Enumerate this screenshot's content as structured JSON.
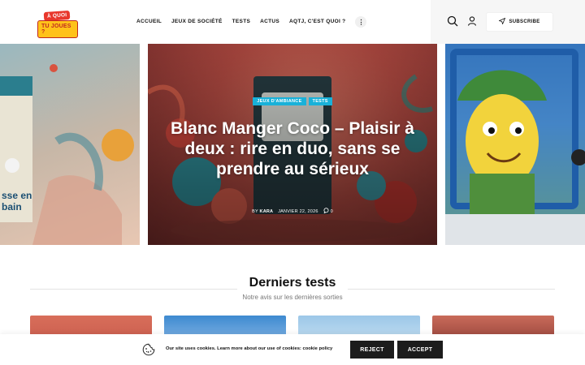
{
  "site": {
    "logo_line1": "À QUOI",
    "logo_line2": "TU JOUES ?"
  },
  "nav": {
    "items": [
      "ACCUEIL",
      "JEUX DE SOCIÉTÉ",
      "TESTS",
      "ACTUS",
      "AQTJ, C'EST QUOI ?"
    ],
    "more": "⋮"
  },
  "header": {
    "subscribe_label": "SUBSCRIBE"
  },
  "carousel": {
    "left_text_line1": "sse en",
    "left_text_line2": "bain",
    "main": {
      "tags": [
        "JEUX D'AMBIANCE",
        "TESTS"
      ],
      "title": "Blanc Manger Coco – Plaisir à deux : rire en duo, sans se prendre au sérieux",
      "by": "BY",
      "author": "KARA",
      "date": "JANVIER 22, 2026",
      "comments": "0"
    }
  },
  "section": {
    "title": "Derniers tests",
    "subtitle": "Notre avis sur les dernières sorties"
  },
  "cookie": {
    "text": "Our site uses cookies. Learn more about our use of cookies:",
    "link": "cookie policy",
    "reject": "REJECT",
    "accept": "ACCEPT"
  },
  "colors": {
    "accent": "#19b1d9",
    "logo_red": "#e8372c",
    "logo_yellow": "#ffc21a",
    "button_dark": "#1c1c1c"
  }
}
